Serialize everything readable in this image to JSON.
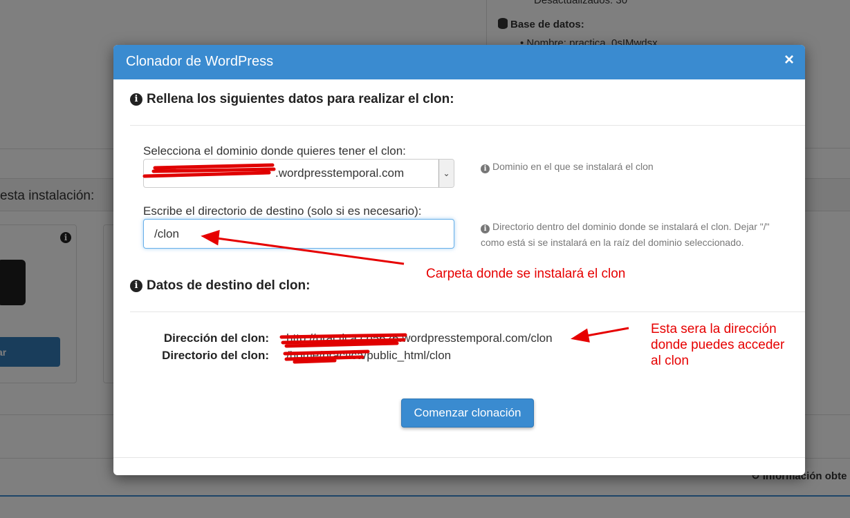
{
  "background": {
    "right_panel": {
      "outdated_text": "Desactualizados: 30",
      "db_heading": "Base de datos:",
      "db_name": "Nombre: practica_0sIMwdsx"
    },
    "section_title": "esta instalación:",
    "card_button_label": "ar",
    "footer_info": "Información obte"
  },
  "modal": {
    "title": "Clonador de WordPress",
    "close_label": "×",
    "section1_heading": "Rellena los siguientes datos para realizar el clon:",
    "domain_label": "Selecciona el dominio donde quieres tener el clon:",
    "domain_value": ".wordpresstemporal.com",
    "domain_help": "Dominio en el que se instalará el clon",
    "dir_label": "Escribe el directorio de destino (solo si es necesario):",
    "dir_value": "/clon",
    "dir_help_line1": "Directorio dentro del dominio donde se instalará el clon. Dejar \"/\"",
    "dir_help_line2": "como está si se instalará en la raíz del dominio seleccionado.",
    "section2_heading": "Datos de destino del clon:",
    "clone_address_label": "Dirección del clon:",
    "clone_address_value": "http://practica.cp5626.wordpresstemporal.com/clon",
    "clone_directory_label": "Directorio del clon:",
    "clone_directory_value": "/home/practica/public_html/clon",
    "submit_label": "Comenzar clonación"
  },
  "annotations": {
    "folder_note": "Carpeta donde se instalará el clon",
    "address_note_line1": "Esta sera la dirección",
    "address_note_line2": "donde puedes acceder",
    "address_note_line3": "al clon"
  },
  "colors": {
    "modal_header": "#3a8bd0",
    "annotation_red": "#e60000",
    "primary_button": "#3a8bd0"
  }
}
